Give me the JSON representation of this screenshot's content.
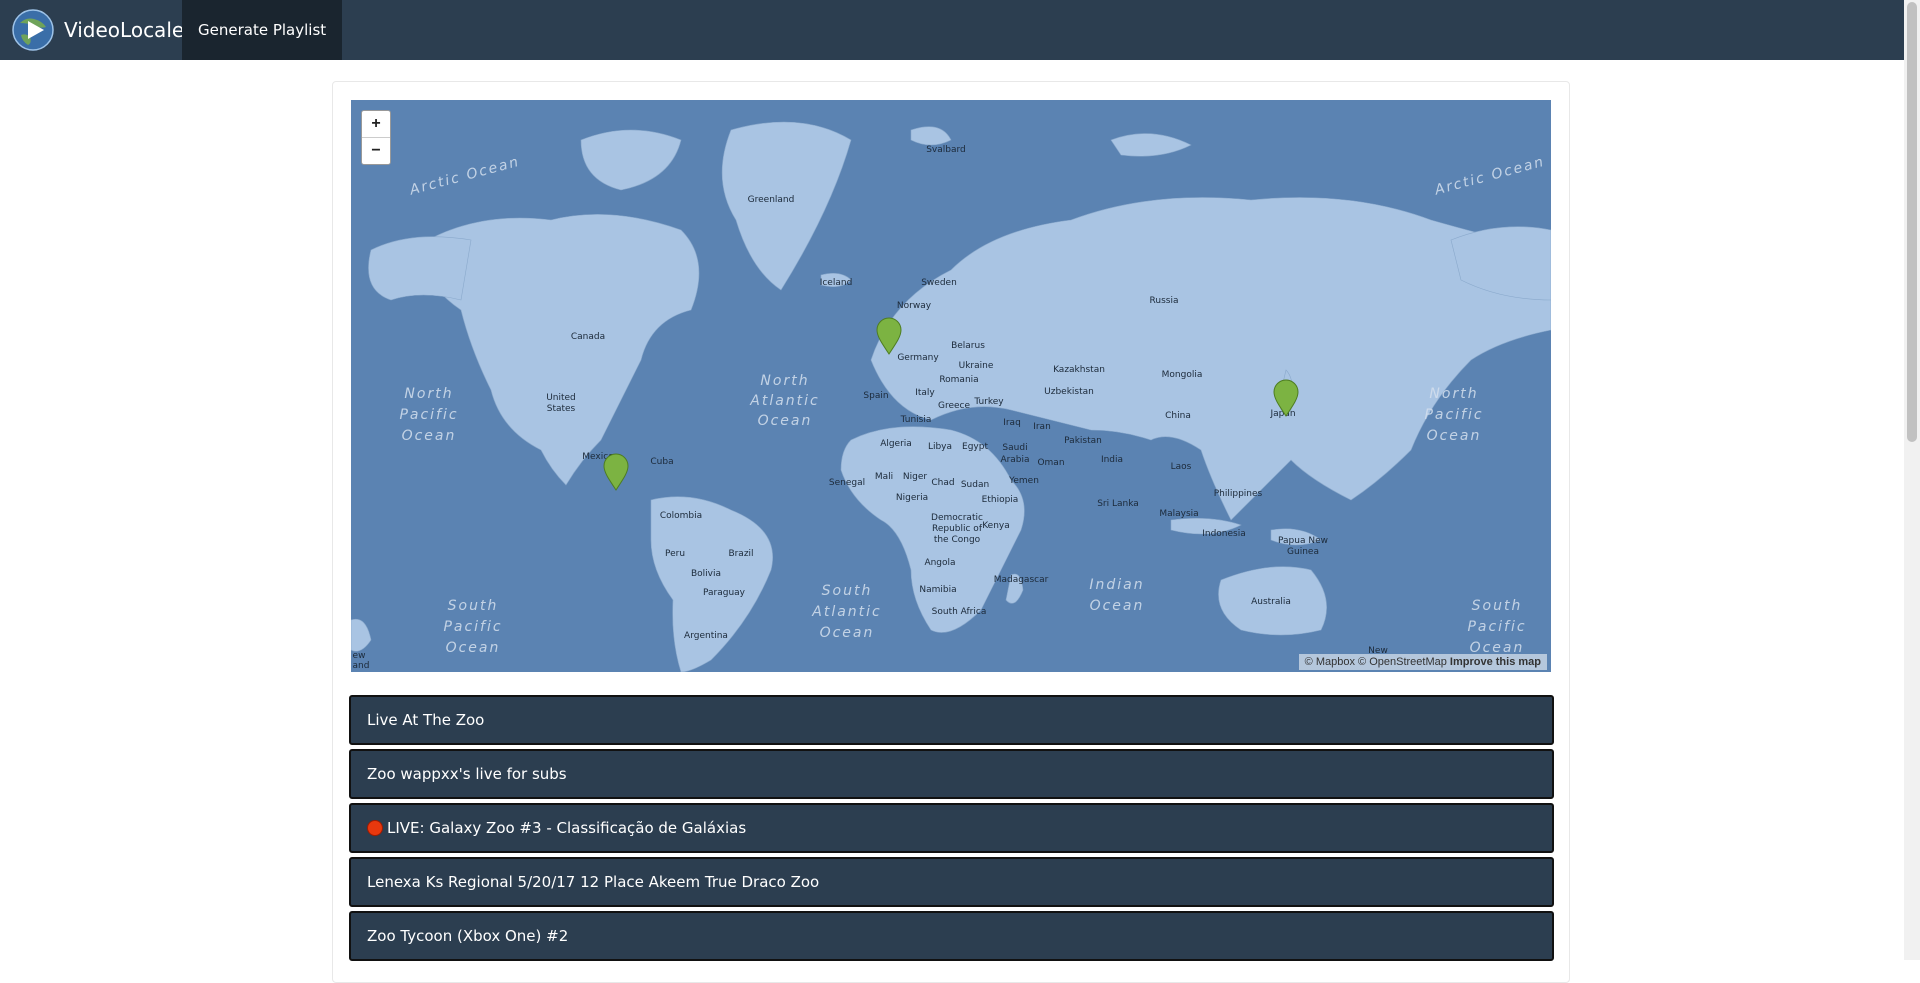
{
  "navbar": {
    "brand": "VideoLocale",
    "link": "Generate Playlist"
  },
  "map": {
    "zoom_in": "+",
    "zoom_out": "−",
    "attribution": {
      "mapbox": "© Mapbox",
      "osm": "© OpenStreetMap",
      "improve": "Improve this map"
    },
    "ocean_labels": {
      "arctic_left": "Arctic Ocean",
      "arctic_right": "Arctic Ocean",
      "north_pacific_left": [
        "North",
        "Pacific",
        "Ocean"
      ],
      "north_atlantic": [
        "North",
        "Atlantic",
        "Ocean"
      ],
      "north_pacific_right": [
        "North",
        "Pacific",
        "Ocean"
      ],
      "south_pacific_left": [
        "South",
        "Pacific",
        "Ocean"
      ],
      "south_atlantic": [
        "South",
        "Atlantic",
        "Ocean"
      ],
      "indian": [
        "Indian",
        "Ocean"
      ],
      "south_pacific_right": [
        "South",
        "Pacific",
        "Ocean"
      ]
    },
    "country_labels": {
      "svalbard": "Svalbard",
      "greenland": "Greenland",
      "iceland": "Iceland",
      "sweden": "Sweden",
      "norway": "Norway",
      "russia": "Russia",
      "canada": "Canada",
      "belarus": "Belarus",
      "germany": "Germany",
      "ukraine": "Ukraine",
      "kazakhstan": "Kazakhstan",
      "mongolia": "Mongolia",
      "romania": "Romania",
      "spain": "Spain",
      "italy": "Italy",
      "uzbekistan": "Uzbekistan",
      "turkey": "Turkey",
      "greece": "Greece",
      "united_states_1": "United",
      "united_states_2": "States",
      "china": "China",
      "japan": "Japan",
      "tunisia": "Tunisia",
      "iraq": "Iraq",
      "iran": "Iran",
      "pakistan": "Pakistan",
      "algeria": "Algeria",
      "libya": "Libya",
      "egypt": "Egypt",
      "saudi_1": "Saudi",
      "saudi_2": "Arabia",
      "oman": "Oman",
      "india": "India",
      "mexico": "Mexico",
      "cuba": "Cuba",
      "laos": "Laos",
      "yemen": "Yemen",
      "mali": "Mali",
      "niger": "Niger",
      "senegal": "Senegal",
      "chad": "Chad",
      "sudan": "Sudan",
      "philippines": "Philippines",
      "nigeria": "Nigeria",
      "ethiopia": "Ethiopia",
      "sri_lanka": "Sri Lanka",
      "malaysia": "Malaysia",
      "colombia": "Colombia",
      "drc_1": "Democratic",
      "drc_2": "Republic of",
      "drc_3": "the Congo",
      "kenya": "Kenya",
      "indonesia": "Indonesia",
      "png_1": "Papua New",
      "png_2": "Guinea",
      "peru": "Peru",
      "brazil": "Brazil",
      "bolivia": "Bolivia",
      "angola": "Angola",
      "namibia": "Namibia",
      "madagascar": "Madagascar",
      "paraguay": "Paraguay",
      "australia": "Australia",
      "south_africa": "South Africa",
      "argentina": "Argentina",
      "new_zealand": "New",
      "nz_edge_1": "ew",
      "nz_edge_2": "and"
    },
    "colors": {
      "water": "#5b83b2",
      "land": "#a9c4e3",
      "marker": "#7cb342"
    }
  },
  "videos": [
    {
      "title": "Live At The Zoo",
      "live": false
    },
    {
      "title": "Zoo wappxx's live for subs",
      "live": false
    },
    {
      "title": "LIVE: Galaxy Zoo #3 - Classificação de Galáxias",
      "live": true
    },
    {
      "title": "Lenexa Ks Regional 5/20/17 12 Place Akeem True Draco Zoo",
      "live": false
    },
    {
      "title": "Zoo Tycoon (Xbox One) #2",
      "live": false
    }
  ]
}
